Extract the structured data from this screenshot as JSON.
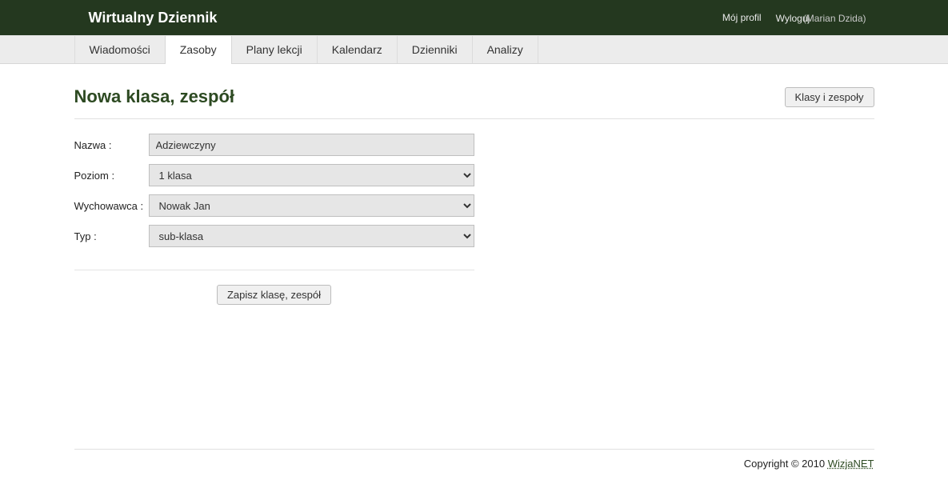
{
  "header": {
    "app_title": "Wirtualny Dziennik",
    "profile_link": "Mój profil",
    "logout_label": "Wyloguj",
    "user_name": "(Marian Dzida)"
  },
  "tabs": [
    {
      "label": "Wiadomości",
      "active": false
    },
    {
      "label": "Zasoby",
      "active": true
    },
    {
      "label": "Plany lekcji",
      "active": false
    },
    {
      "label": "Kalendarz",
      "active": false
    },
    {
      "label": "Dzienniki",
      "active": false
    },
    {
      "label": "Analizy",
      "active": false
    }
  ],
  "page": {
    "title": "Nowa klasa, zespół",
    "action_button": "Klasy i zespoły"
  },
  "form": {
    "name_label": "Nazwa :",
    "name_value": "Adziewczyny",
    "level_label": "Poziom :",
    "level_value": "1 klasa",
    "teacher_label": "Wychowawca :",
    "teacher_value": "Nowak Jan",
    "type_label": "Typ :",
    "type_value": "sub-klasa",
    "submit_label": "Zapisz klasę, zespół"
  },
  "footer": {
    "copyright": "Copyright © 2010 ",
    "link": "WizjaNET"
  }
}
